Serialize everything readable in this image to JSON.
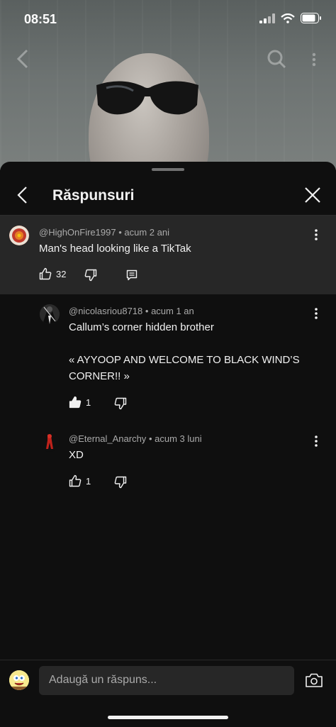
{
  "status_bar": {
    "time": "08:51"
  },
  "sheet": {
    "title": "Răspunsuri"
  },
  "comments": [
    {
      "author": "@HighOnFire1997",
      "age": "acum 2 ani",
      "text": "Man's head looking like a TikTak",
      "likes": "32",
      "liked": false
    },
    {
      "author": "@nicolasriou8718",
      "age": "acum 1 an",
      "text_lines": [
        "Callum’s corner hidden brother",
        "",
        "« AYYOOP AND WELCOME TO BLACK WIND’S CORNER!! »"
      ],
      "likes": "1",
      "liked": true
    },
    {
      "author": "@Eternal_Anarchy",
      "age": "acum 3 luni",
      "text": "XD",
      "likes": "1",
      "liked": false
    }
  ],
  "composer": {
    "placeholder": "Adaugă un răspuns..."
  },
  "colors": {
    "sheet_bg": "#0f0f0f",
    "parent_bg": "#272727",
    "meta": "#aaaaaa",
    "text": "#f1f1f1"
  },
  "icons": [
    "back-icon",
    "search-icon",
    "more-icon",
    "close-icon",
    "thumbs-up-icon",
    "thumbs-down-icon",
    "reply-icon",
    "camera-icon"
  ]
}
